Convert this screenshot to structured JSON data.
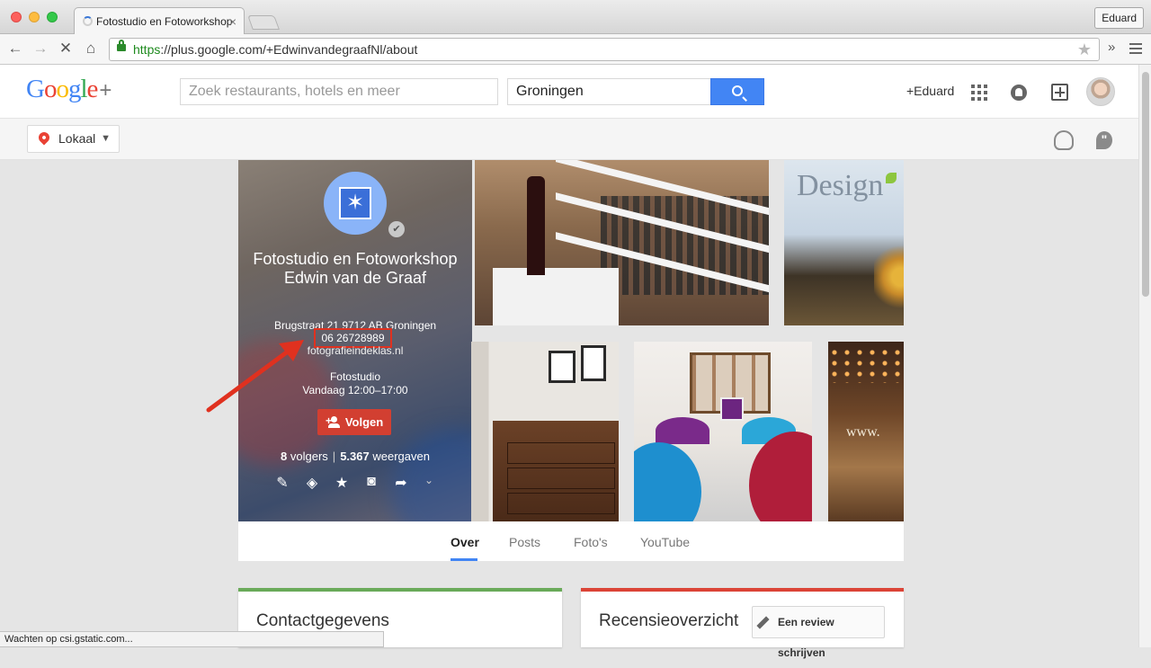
{
  "browser": {
    "tab_title": "Fotostudio en Fotoworkshop",
    "profile_button": "Eduard",
    "url_https": "https",
    "url_rest": "://plus.google.com/+EdwinvandegraafNl/about",
    "status_text": "Wachten op csi.gstatic.com..."
  },
  "header": {
    "logo_text": "Google",
    "logo_plus": "+",
    "search_placeholder": "Zoek restaurants, hotels en meer",
    "location_value": "Groningen",
    "user_link": "+Eduard"
  },
  "subbar": {
    "lokaal_label": "Lokaal"
  },
  "profile": {
    "name": "Fotostudio en Fotoworkshop Edwin van de Graaf",
    "address": "Brugstraat 21 9712 AB Groningen",
    "phone": "06 26728989",
    "website": "fotografieindeklas.nl",
    "category": "Fotostudio",
    "hours": "Vandaag 12:00–17:00",
    "follow_label": "Volgen",
    "followers_count": "8",
    "followers_label": "volgers",
    "views_count": "5.367",
    "views_label": "weergaven"
  },
  "photos": {
    "design_text": "Design",
    "www_text": "www."
  },
  "tabs": [
    {
      "label": "Over"
    },
    {
      "label": "Posts"
    },
    {
      "label": "Foto's"
    },
    {
      "label": "YouTube"
    }
  ],
  "cards": {
    "contact_title": "Contactgegevens",
    "review_title": "Recensieoverzicht",
    "review_button": "Een review schrijven"
  },
  "colors": {
    "search_button": "#4285f4",
    "follow_button": "#d23f31",
    "highlight_box": "#e0311f",
    "contact_accent": "#6aaa59",
    "review_accent": "#db4437"
  }
}
